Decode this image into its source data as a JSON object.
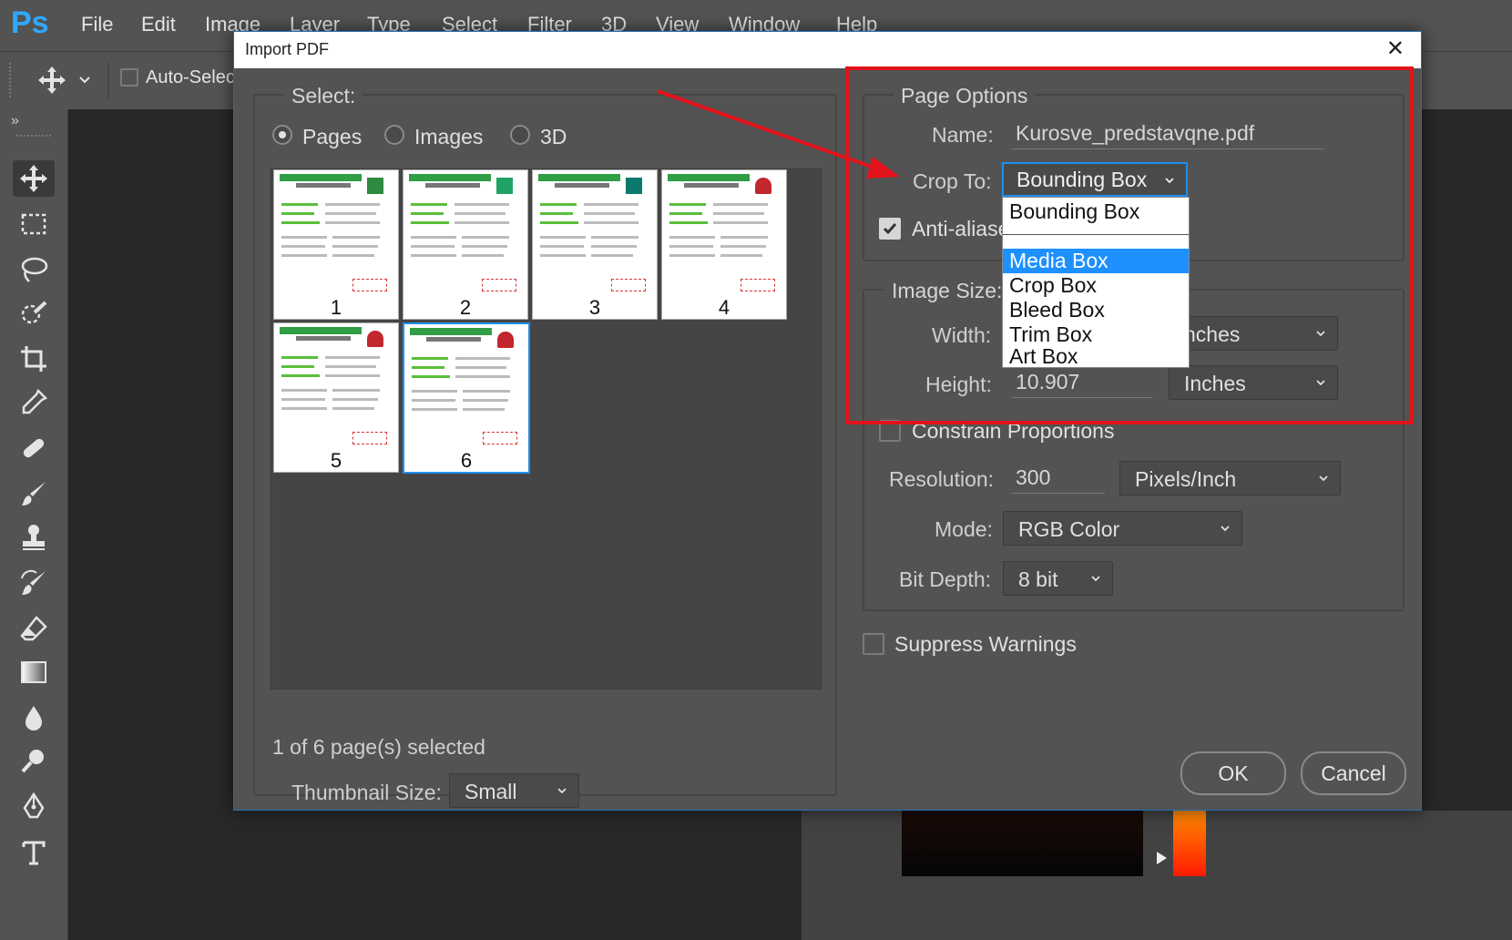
{
  "app": {
    "logo": "Ps",
    "menu": [
      "File",
      "Edit",
      "Image",
      "Layer",
      "Type",
      "Select",
      "Filter",
      "3D",
      "View",
      "Window",
      "Help"
    ],
    "options_bar": {
      "auto_select": "Auto-Select"
    }
  },
  "tools": [
    "move-tool",
    "marquee-tool",
    "lasso-tool",
    "quick-select-tool",
    "crop-tool",
    "eyedropper-tool",
    "healing-tool",
    "brush-tool",
    "stamp-tool",
    "history-brush-tool",
    "eraser-tool",
    "gradient-tool",
    "blur-tool",
    "dodge-tool",
    "pen-tool",
    "type-tool"
  ],
  "dialog": {
    "title": "Import PDF",
    "close": "✕",
    "select": {
      "legend": "Select:",
      "options": [
        "Pages",
        "Images",
        "3D"
      ],
      "selected_option": "Pages",
      "pages": [
        "1",
        "2",
        "3",
        "4",
        "5",
        "6"
      ],
      "selected_page": "6",
      "status": "1 of 6 page(s) selected",
      "thumbnail_size_label": "Thumbnail Size:",
      "thumbnail_size_value": "Small"
    },
    "page_options": {
      "legend": "Page Options",
      "name_label": "Name:",
      "name_value": "Kurosve_predstavqne.pdf",
      "crop_label": "Crop To:",
      "crop_value": "Bounding Box",
      "crop_options": [
        "Bounding Box",
        "Media Box",
        "Crop Box",
        "Bleed Box",
        "Trim Box",
        "Art Box"
      ],
      "crop_highlighted": "Media Box",
      "anti_aliased_label": "Anti-aliase",
      "anti_aliased_checked": true
    },
    "image_size": {
      "legend": "Image Size:",
      "width_label": "Width:",
      "width_unit": "nches",
      "height_label": "Height:",
      "height_value": "10.907",
      "height_unit": "Inches",
      "constrain_label": "Constrain Proportions",
      "constrain_checked": false,
      "resolution_label": "Resolution:",
      "resolution_value": "300",
      "resolution_unit": "Pixels/Inch",
      "mode_label": "Mode:",
      "mode_value": "RGB Color",
      "bit_depth_label": "Bit Depth:",
      "bit_depth_value": "8 bit"
    },
    "suppress_warnings_label": "Suppress Warnings",
    "suppress_warnings_checked": false,
    "ok_label": "OK",
    "cancel_label": "Cancel"
  },
  "colors": {
    "accent": "#1c8ff0",
    "annotation_red": "#e3131b",
    "dialog_bg": "#535353",
    "ps_blue": "#31a8ff"
  }
}
